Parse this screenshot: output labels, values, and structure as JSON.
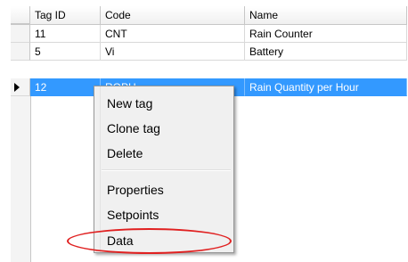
{
  "grid": {
    "columns": [
      "Tag ID",
      "Code",
      "Name"
    ],
    "rows": [
      {
        "id": "11",
        "code": "CNT",
        "name": "Rain Counter"
      },
      {
        "id": "5",
        "code": "Vi",
        "name": "Battery"
      },
      {
        "id": "12",
        "code": "RQPH",
        "name": "Rain Quantity per Hour"
      }
    ],
    "selected_row": 2
  },
  "context_menu": {
    "items": [
      "New tag",
      "Clone tag",
      "Delete",
      "Properties",
      "Setpoints",
      "Data"
    ],
    "highlighted_item": "Data"
  },
  "colors": {
    "selection": "#3399ff",
    "highlight_oval": "#e02020"
  }
}
